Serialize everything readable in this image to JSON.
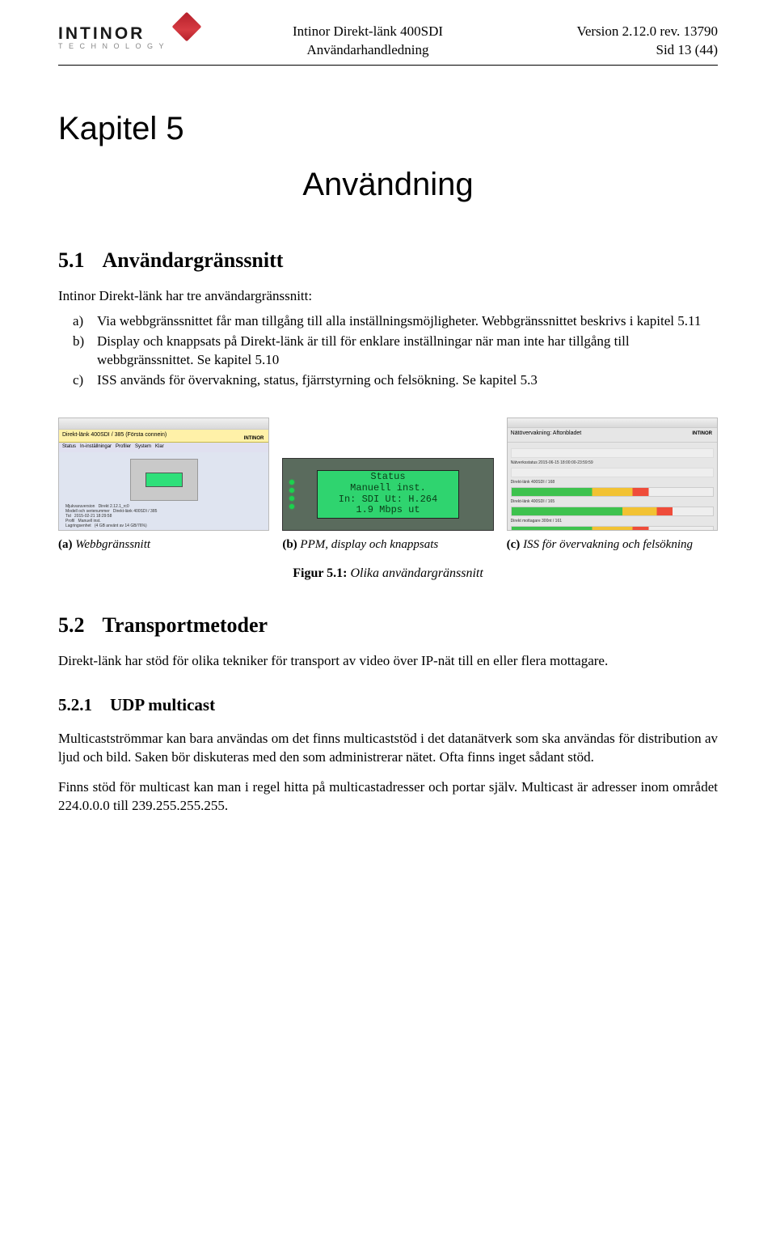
{
  "logo": {
    "brand": "INTINOR",
    "tagline": "TECHNOLOGY"
  },
  "header": {
    "center_line1": "Intinor Direkt-länk 400SDI",
    "center_line2": "Användarhandledning",
    "right_line1": "Version 2.12.0 rev. 13790",
    "right_line2": "Sid 13 (44)"
  },
  "chapter": {
    "label": "Kapitel 5",
    "title": "Användning"
  },
  "section_5_1": {
    "num": "5.1",
    "title": "Användargränssnitt",
    "intro": "Intinor Direkt-länk har tre användargränssnitt:",
    "items": [
      {
        "marker": "a)",
        "text": "Via webbgränssnittet får man tillgång till alla inställningsmöjligheter. Webbgränssnittet beskrivs i kapitel 5.11"
      },
      {
        "marker": "b)",
        "text": "Display och knappsats på Direkt-länk är till för enklare inställningar när man inte har tillgång till webbgränssnittet. Se kapitel 5.10"
      },
      {
        "marker": "c)",
        "text": "ISS används för övervakning, status, fjärrstyrning och felsökning. Se kapitel 5.3"
      }
    ]
  },
  "figures": {
    "a": {
      "label": "(a)",
      "caption": "Webbgränssnitt",
      "banner": "Direkt-länk 400SDI / 385 (Första connein)"
    },
    "b": {
      "label": "(b)",
      "caption": "PPM, display och knappsats",
      "screen_line1": "Status",
      "screen_line2": "Manuell inst.",
      "screen_line3": "In: SDI Ut: H.264",
      "screen_line4": "1.9 Mbps ut"
    },
    "c": {
      "label": "(c)",
      "caption": "ISS för övervakning och felsökning",
      "bar_title": "Nätövervakning: Aftonbladet",
      "row1": "Nätverksstatus 2015-06-15 18:00:00-23:59:59"
    },
    "main": {
      "bold": "Figur 5.1:",
      "italic": "Olika användargränssnitt"
    }
  },
  "section_5_2": {
    "num": "5.2",
    "title": "Transportmetoder",
    "para": "Direkt-länk har stöd för olika tekniker för transport av video över IP-nät till en eller flera mottagare."
  },
  "section_5_2_1": {
    "num": "5.2.1",
    "title": "UDP multicast",
    "para1": "Multicastströmmar kan bara användas om det finns multicaststöd i det datanätverk som ska användas för distribution av ljud och bild. Saken bör diskuteras med den som administrerar nätet. Ofta finns inget sådant stöd.",
    "para2": "Finns stöd för multicast kan man i regel hitta på multicastadresser och portar själv. Multicast är adresser inom området 224.0.0.0 till 239.255.255.255."
  }
}
